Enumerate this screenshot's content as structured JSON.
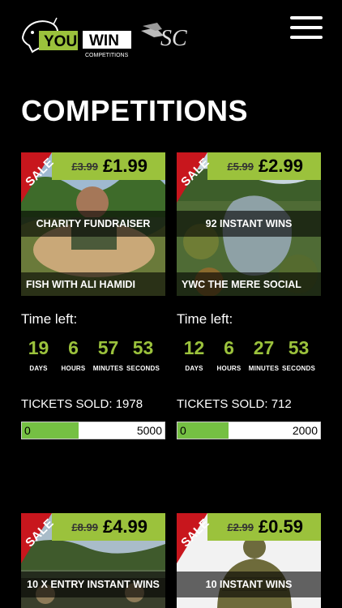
{
  "header": {
    "logo_you": "YOU",
    "logo_win": "WIN",
    "logo_sub": "COMPETITIONS",
    "partner_logo": "SC"
  },
  "page_title": "COMPETITIONS",
  "sale_label": "SALE",
  "time_left_label": "Time left:",
  "units": [
    "DAYS",
    "HOURS",
    "MINUTES",
    "SECONDS"
  ],
  "tickets_sold_prefix": "TICKETS SOLD:",
  "colors": {
    "accent": "#9bc23c",
    "ribbon": "#c8161d",
    "progress": "#75c043",
    "background": "#000000"
  },
  "cards": [
    {
      "old_price": "£3.99",
      "new_price": "£1.99",
      "banner_top": "CHARITY FUNDRAISER",
      "banner_bottom": "FISH WITH ALI HAMIDI",
      "countdown": [
        "19",
        "6",
        "57",
        "53"
      ],
      "tickets_sold": "1978",
      "progress_min": "0",
      "progress_max": "5000",
      "progress_fraction": 0.3956,
      "tickets_text": "TICKETS SOLD: 1978"
    },
    {
      "old_price": "£5.99",
      "new_price": "£2.99",
      "banner_top": "92 INSTANT WINS",
      "banner_bottom": "YWC THE MERE SOCIAL",
      "countdown": [
        "12",
        "6",
        "27",
        "53"
      ],
      "tickets_sold": "712",
      "progress_min": "0",
      "progress_max": "2000",
      "progress_fraction": 0.356,
      "tickets_text": "TICKETS SOLD: 712"
    },
    {
      "old_price": "£8.99",
      "new_price": "£4.99",
      "banner_top": "10 X ENTRY INSTANT WINS"
    },
    {
      "old_price": "£2.99",
      "new_price": "£0.59",
      "banner_top": "10 INSTANT WINS"
    }
  ]
}
